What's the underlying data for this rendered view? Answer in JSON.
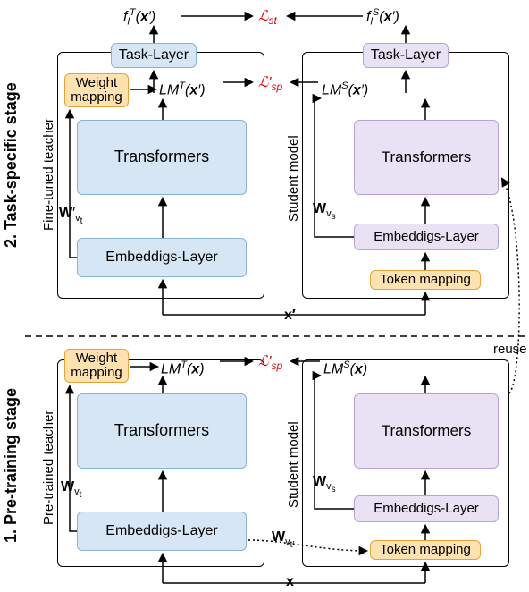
{
  "diagram": {
    "stages": {
      "task": "2. Task-specific stage",
      "pretrain": "1. Pre-training stage"
    },
    "teacher_label": "Fine-tuned teacher",
    "pretrained_teacher_label": "Pre-trained teacher",
    "student_label": "Student model",
    "blocks": {
      "transformers": "Transformers",
      "embeddings": "Embeddigs-Layer",
      "task_layer": "Task-Layer",
      "weight_mapping": "Weight\nmapping",
      "token_mapping": "Token mapping"
    },
    "math": {
      "f_T": "f_l^T( x' )",
      "f_S": "f_l^S( x' )",
      "LM_T_xp": "LM^T(x')",
      "LM_S_xp": "LM^S(x')",
      "LM_T_x": "LM^T(x)",
      "LM_S_x": "LM^S(x)",
      "L_st": "ℒ_st",
      "L_sp": "ℒ'_sp",
      "W_vt": "W_{v_t}",
      "W_vtp": "W'_{v_t}",
      "W_vs": "W_{v_s}",
      "W_vtp2": "W_{v_t'}",
      "x": "x",
      "xp": "x'",
      "reuse": "reuse"
    }
  }
}
